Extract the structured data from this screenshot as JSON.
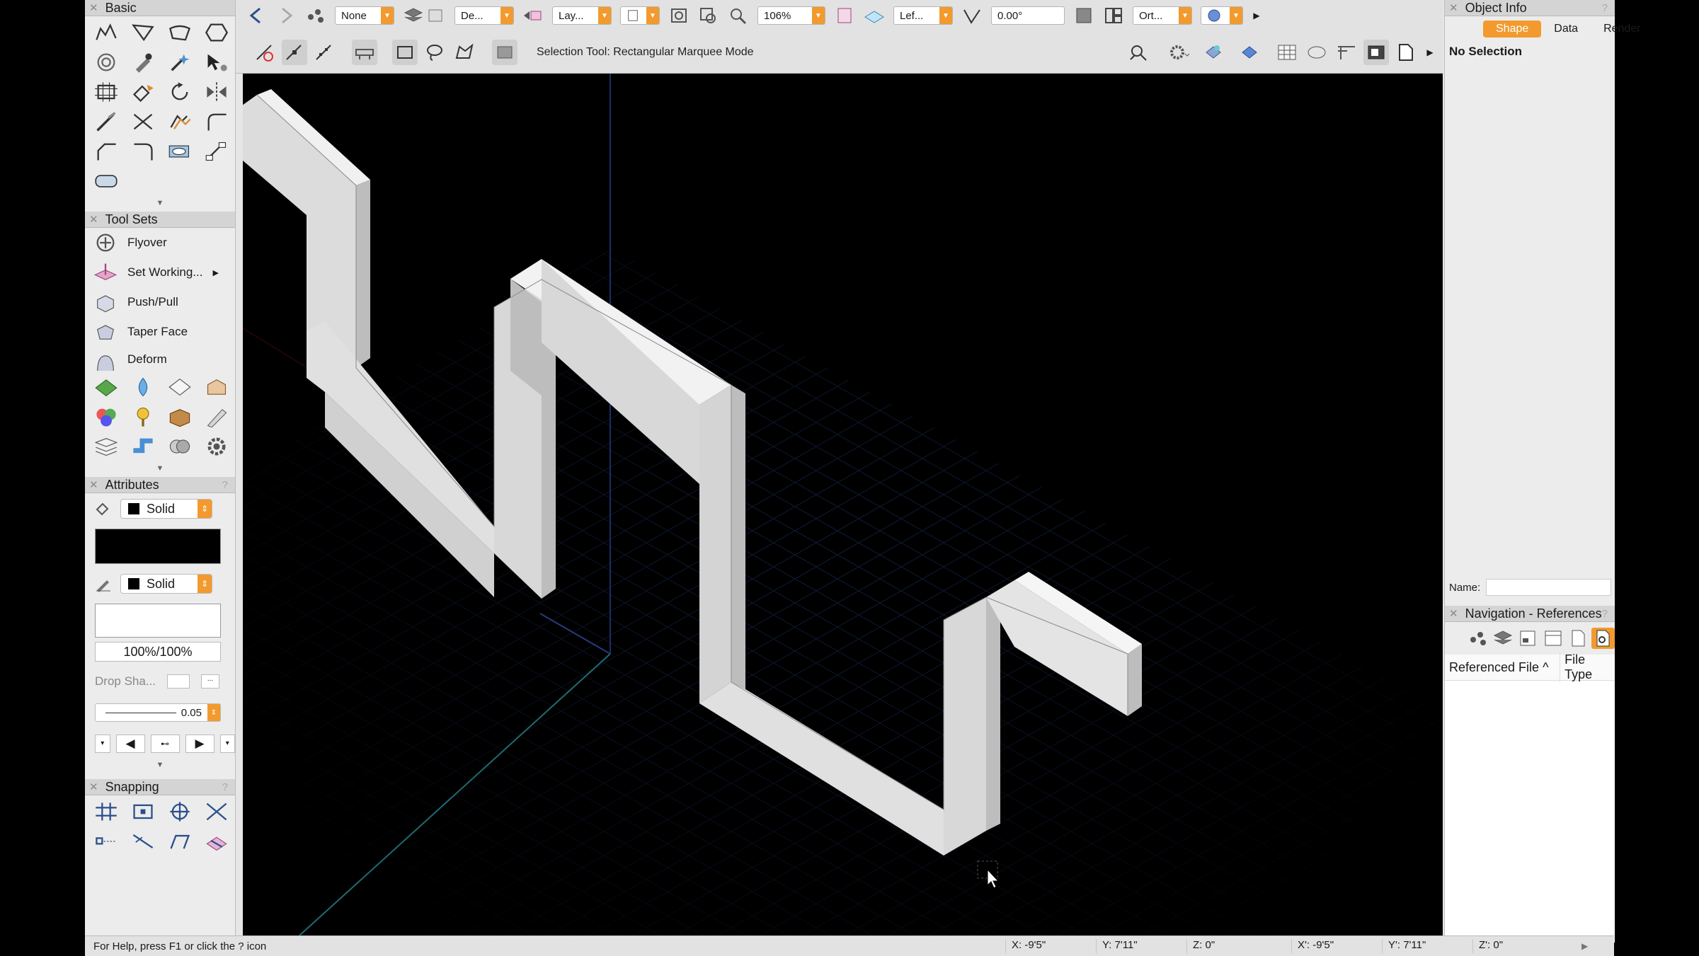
{
  "basic_palette": {
    "title": "Basic"
  },
  "tool_sets": {
    "title": "Tool Sets",
    "items": [
      {
        "label": "Flyover"
      },
      {
        "label": "Set Working..."
      },
      {
        "label": "Push/Pull"
      },
      {
        "label": "Taper Face"
      },
      {
        "label": "Deform"
      }
    ]
  },
  "attributes": {
    "title": "Attributes",
    "fill_style": "Solid",
    "pen_style": "Solid",
    "opacity": "100%/100%",
    "drop_shadow": "Drop Sha...",
    "line_weight": "0.05"
  },
  "snapping": {
    "title": "Snapping"
  },
  "toolbar": {
    "class_dropdown": "None",
    "design_layer": "De...",
    "layer": "Lay...",
    "zoom": "106%",
    "view": "Lef...",
    "rotation": "0.00°",
    "projection": "Ort...",
    "mode_message": "Selection Tool: Rectangular Marquee Mode"
  },
  "object_info": {
    "title": "Object Info",
    "tabs": [
      "Shape",
      "Data",
      "Render"
    ],
    "active_tab": "Shape",
    "selection": "No Selection",
    "name_label": "Name:"
  },
  "navigation": {
    "title": "Navigation - References",
    "columns": [
      "Referenced File ^",
      "File Type"
    ]
  },
  "status_bar": {
    "help": "For Help, press F1 or click the ? icon",
    "x": "X: -9'5\"",
    "y": "Y: 7'11\"",
    "z": "Z: 0\"",
    "x2": "X': -9'5\"",
    "y2": "Y': 7'11\"",
    "z2": "Z': 0\""
  },
  "colors": {
    "accent": "#f29a2e",
    "canvas": "#000000",
    "wall": "#e8e8e8"
  }
}
